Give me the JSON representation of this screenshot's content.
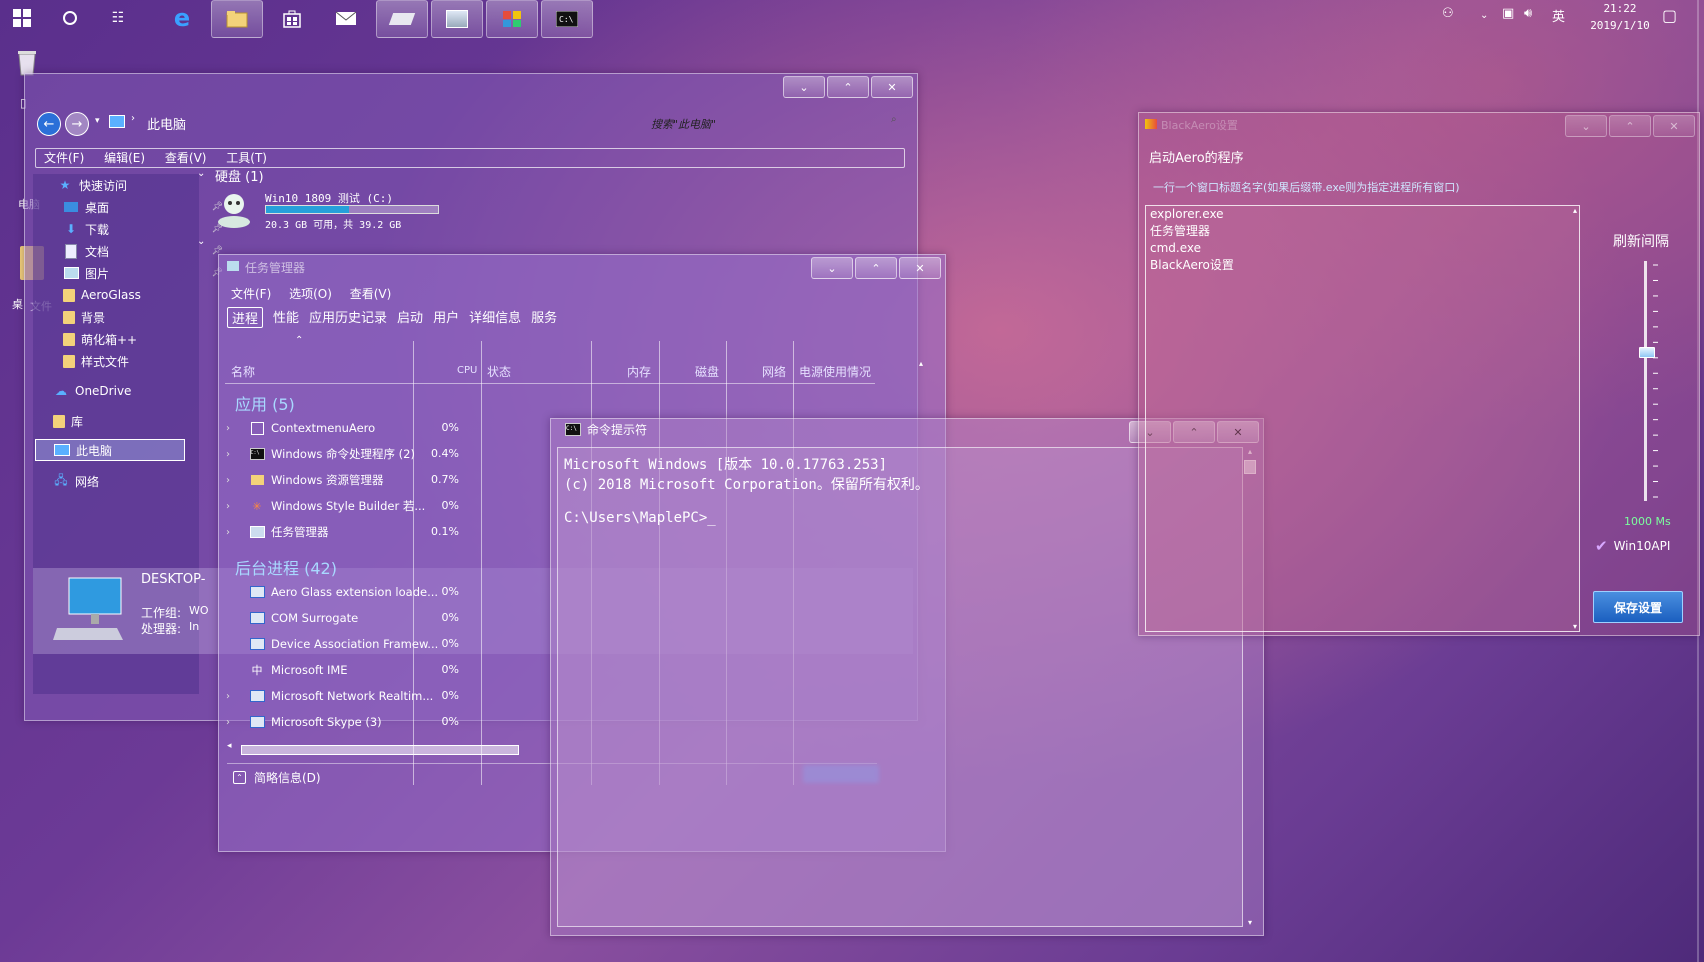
{
  "taskbar": {
    "tray_lang": "英",
    "clock_time": "21:22",
    "clock_date": "2019/1/10"
  },
  "explorer": {
    "path": "此电脑",
    "search_placeholder": "搜索\"此电脑\"",
    "menu": [
      "文件(F)",
      "编辑(E)",
      "查看(V)",
      "工具(T)"
    ],
    "sidebar": [
      {
        "label": "快速访问",
        "icon": "star-icon"
      },
      {
        "label": "桌面",
        "icon": "desktop-icon"
      },
      {
        "label": "下载",
        "icon": "download-icon"
      },
      {
        "label": "文档",
        "icon": "document-icon"
      },
      {
        "label": "图片",
        "icon": "picture-icon"
      },
      {
        "label": "AeroGlass",
        "icon": "folder-icon"
      },
      {
        "label": "背景",
        "icon": "folder-icon"
      },
      {
        "label": "萌化箱++",
        "icon": "folder-icon"
      },
      {
        "label": "样式文件",
        "icon": "folder-icon"
      },
      {
        "label": "OneDrive",
        "icon": "cloud-icon"
      },
      {
        "label": "库",
        "icon": "library-icon"
      },
      {
        "label": "此电脑",
        "icon": "computer-icon"
      },
      {
        "label": "网络",
        "icon": "network-icon"
      }
    ],
    "section_disks": "硬盘 (1)",
    "disk_name": "Win10 1809 测试 (C:)",
    "disk_usage": "20.3 GB 可用，共 39.2 GB",
    "disk_used_fraction": 0.48,
    "details_name": "DESKTOP-",
    "details_workgroup_label": "工作组:",
    "details_workgroup_value": "WO",
    "details_cpu_label": "处理器:",
    "details_cpu_value": "In",
    "left_clipped_1": "电脑",
    "left_clipped_2": "桌",
    "left_clipped_3": "文件"
  },
  "taskmgr": {
    "title": "任务管理器",
    "menu": [
      "文件(F)",
      "选项(O)",
      "查看(V)"
    ],
    "tabs": [
      "进程",
      "性能",
      "应用历史记录",
      "启动",
      "用户",
      "详细信息",
      "服务"
    ],
    "columns": {
      "name": "名称",
      "cpu": "CPU",
      "status": "状态",
      "memory": "内存",
      "disk": "磁盘",
      "network": "网络",
      "power": "电源使用情况"
    },
    "group_apps": "应用 (5)",
    "group_bg": "后台进程 (42)",
    "apps": [
      {
        "name": "ContextmenuAero",
        "cpu": "0%",
        "icon": "blank-icon"
      },
      {
        "name": "Windows 命令处理程序 (2)",
        "cpu": "0.4%",
        "icon": "cmd-icon"
      },
      {
        "name": "Windows 资源管理器",
        "cpu": "0.7%",
        "icon": "folder-icon"
      },
      {
        "name": "Windows Style Builder 若...",
        "cpu": "0%",
        "icon": "star-burst-icon"
      },
      {
        "name": "任务管理器",
        "cpu": "0.1%",
        "icon": "taskmgr-icon"
      }
    ],
    "bg": [
      {
        "name": "Aero Glass extension loade...",
        "cpu": "0%"
      },
      {
        "name": "COM Surrogate",
        "cpu": "0%"
      },
      {
        "name": "Device Association Framew...",
        "cpu": "0%"
      },
      {
        "name": "Microsoft IME",
        "cpu": "0%"
      },
      {
        "name": "Microsoft Network Realtim...",
        "cpu": "0%"
      },
      {
        "name": "Microsoft Skype (3)",
        "cpu": "0%"
      }
    ],
    "fewer_details": "简略信息(D)"
  },
  "cmd": {
    "title": "命令提示符",
    "line1": "Microsoft Windows [版本 10.0.17763.253]",
    "line2": "(c) 2018 Microsoft Corporation。保留所有权利。",
    "prompt": "C:\\Users\\MaplePC>"
  },
  "blackaero": {
    "title": "BlackAero设置",
    "heading": "启动Aero的程序",
    "hint": "一行一个窗口标题名字(如果后缀带.exe则为指定进程所有窗口)",
    "list": [
      "explorer.exe",
      "任务管理器",
      "cmd.exe",
      "BlackAero设置"
    ],
    "refresh_label": "刷新间隔",
    "refresh_value": "1000 Ms",
    "slider_level": 0.37,
    "win10api_label": "Win10API",
    "save_label": "保存设置"
  }
}
